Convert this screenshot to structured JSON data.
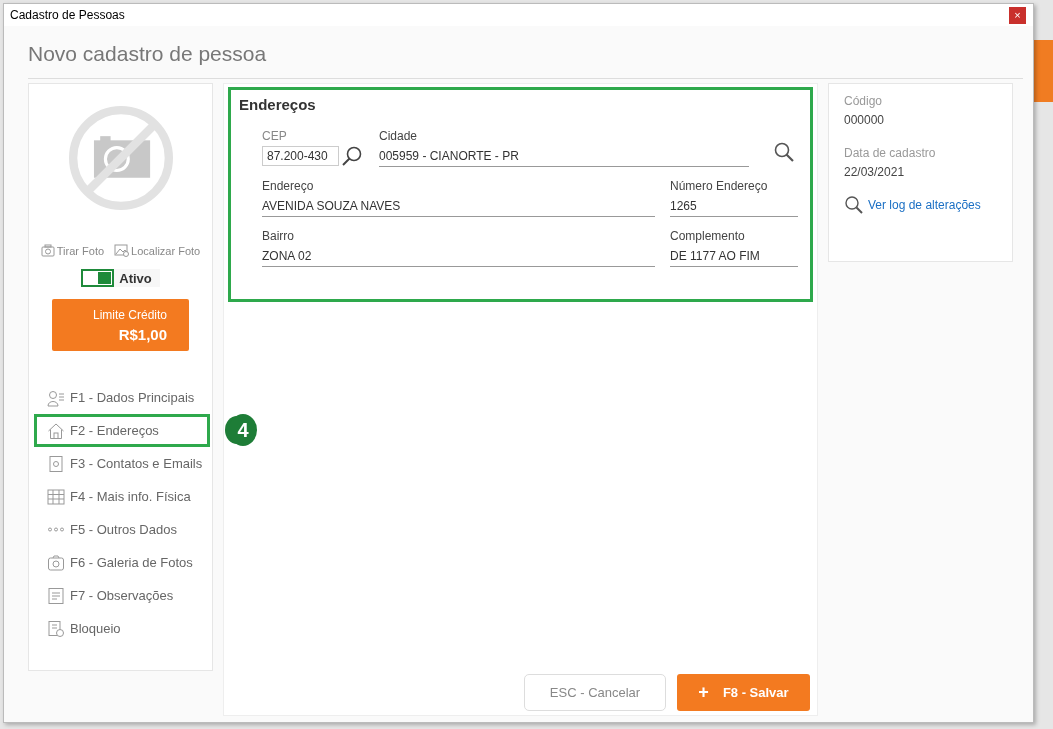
{
  "window": {
    "title": "Cadastro de Pessoas",
    "close": "×"
  },
  "header": {
    "title": "Novo cadastro de pessoa"
  },
  "photo": {
    "actions": [
      "Tirar Foto",
      "Localizar Foto"
    ]
  },
  "status_toggle": {
    "label": "Ativo",
    "on": true
  },
  "credit": {
    "label": "Limite Crédito",
    "value": "R$1,00"
  },
  "nav": [
    {
      "label": "F1 - Dados Principais",
      "highlighted": false
    },
    {
      "label": "F2 - Endereços",
      "highlighted": true
    },
    {
      "label": "F3 - Contatos e Emails",
      "highlighted": false
    },
    {
      "label": "F4 - Mais info. Física",
      "highlighted": false
    },
    {
      "label": "F5 - Outros Dados",
      "highlighted": false
    },
    {
      "label": "F6 - Galeria de Fotos",
      "highlighted": false
    },
    {
      "label": "F7 - Observações",
      "highlighted": false
    },
    {
      "label": "Bloqueio",
      "highlighted": false
    }
  ],
  "callout": {
    "number": "4"
  },
  "section": {
    "title": "Endereços",
    "cep": {
      "label": "CEP",
      "value": "87.200-430"
    },
    "cidade": {
      "label": "Cidade",
      "value": "005959 - CIANORTE - PR"
    },
    "rows": [
      [
        {
          "label": "Endereço",
          "value": "AVENIDA SOUZA NAVES"
        },
        {
          "label": "Número Endereço",
          "value": "1265"
        }
      ],
      [
        {
          "label": "Bairro",
          "value": "ZONA 02"
        },
        {
          "label": "Complemento",
          "value": "DE 1177 AO FIM"
        }
      ]
    ]
  },
  "info": {
    "fields": [
      {
        "label": "Código",
        "value": "000000"
      },
      {
        "label": "Data de cadastro",
        "value": "22/03/2021"
      }
    ],
    "link": "Ver log de alterações"
  },
  "buttons": {
    "cancel": "ESC - Cancelar",
    "save": "F8 - Salvar",
    "save_icon": "+"
  }
}
